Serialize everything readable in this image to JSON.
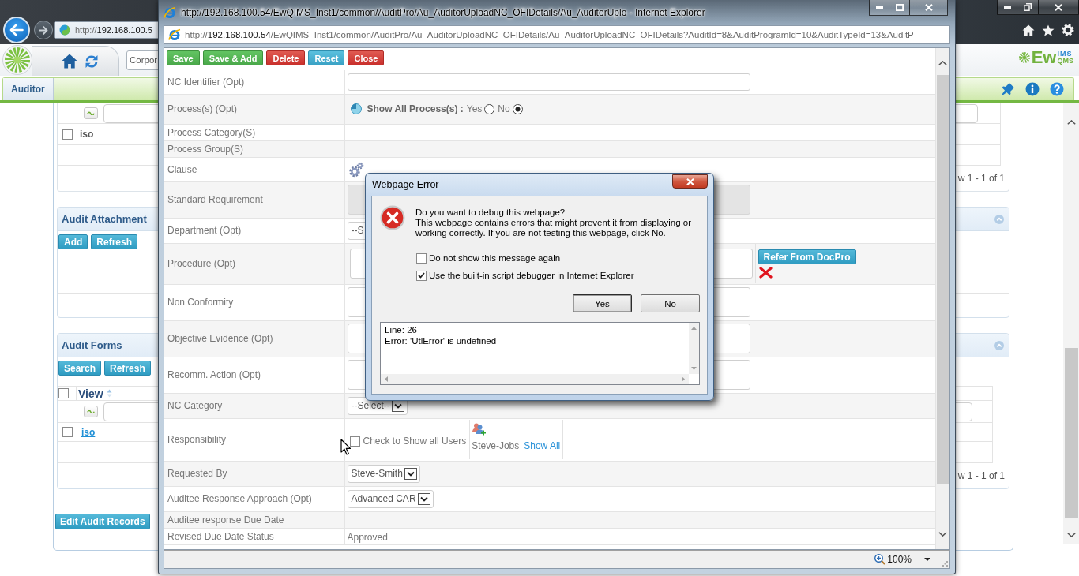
{
  "background_page": {
    "address": {
      "scheme": "http://",
      "host": "192.168.100.5"
    },
    "search_value": "Corpor",
    "brand": {
      "main": "Ew",
      "upper": "IMS",
      "lower": "QMS"
    },
    "tabs": [
      {
        "label": "Auditor",
        "selected": true
      }
    ],
    "top_grid": {
      "rows": [
        {
          "checked": false,
          "text": "iso",
          "link": false
        }
      ],
      "pager": "w 1 - 1 of 1"
    },
    "panels": [
      {
        "title": "Audit Attachment",
        "buttons": [
          "Add",
          "Refresh"
        ]
      },
      {
        "title": "Audit Forms",
        "buttons": [
          "Search",
          "Refresh"
        ],
        "grid": {
          "column": "View",
          "header_checked": false,
          "rows": [
            {
              "checked": false,
              "text": "iso",
              "link": true
            }
          ],
          "pager": "w 1 - 1 of 1"
        }
      }
    ],
    "edit_button": "Edit Audit Records"
  },
  "popup": {
    "title": "http://192.168.100.54/EwQIMS_Inst1/common/AuditPro/Au_AuditorUploadNC_OFIDetails/Au_AuditorUplo - Internet Explorer",
    "address": {
      "scheme": "http://",
      "host": "192.168.100.54",
      "path": "/EwQIMS_Inst1/common/AuditPro/Au_AuditorUploadNC_OFIDetails/Au_AuditorUploadNC_OFIDetails?AuditId=8&AuditProgramId=10&AuditTypeId=13&AuditP"
    },
    "toolbar": [
      {
        "label": "Save",
        "kind": "success"
      },
      {
        "label": "Save & Add",
        "kind": "success"
      },
      {
        "label": "Delete",
        "kind": "danger"
      },
      {
        "label": "Reset",
        "kind": "info"
      },
      {
        "label": "Close",
        "kind": "danger"
      }
    ],
    "form": [
      {
        "label": "NC Identifier (Opt)",
        "kind": "input"
      },
      {
        "label": "Process(s) (Opt)",
        "kind": "radio",
        "prompt": "Show All Process(s) :",
        "options": [
          {
            "label": "Yes",
            "selected": false
          },
          {
            "label": "No",
            "selected": true
          }
        ]
      },
      {
        "label": "Process Category(S)",
        "kind": "empty"
      },
      {
        "label": "Process Group(S)",
        "kind": "empty"
      },
      {
        "label": "Clause",
        "kind": "gear"
      },
      {
        "label": "Standard Requirement",
        "kind": "textarea",
        "disabled": true
      },
      {
        "label": "Department (Opt)",
        "kind": "field",
        "value": "--S"
      },
      {
        "label": "Procedure (Opt)",
        "kind": "textarea",
        "disabled": false,
        "action": "Refer From DocPro"
      },
      {
        "label": "Non Conformity",
        "kind": "textarea",
        "disabled": false
      },
      {
        "label": "Objective Evidence (Opt)",
        "kind": "textarea",
        "disabled": false
      },
      {
        "label": "Recomm. Action (Opt)",
        "kind": "textarea",
        "disabled": false
      },
      {
        "label": "NC Category",
        "kind": "select",
        "value": "--Select--"
      },
      {
        "label": "Responsibility",
        "kind": "users",
        "checkbox": {
          "label": "Check to Show all Users",
          "checked": false
        },
        "user": "Steve-Jobs",
        "link": "Show All"
      },
      {
        "label": "Requested By",
        "kind": "select",
        "value": "Steve-Smith"
      },
      {
        "label": "Auditee Response Approach (Opt)",
        "kind": "select",
        "value": "Advanced CAR"
      },
      {
        "label": "Auditee response Due Date",
        "kind": "empty"
      },
      {
        "label": "Revised Due Date Status",
        "kind": "text",
        "value": "Approved"
      }
    ],
    "zoom": "100%"
  },
  "dialog": {
    "title": "Webpage Error",
    "question": "Do you want to debug this webpage?",
    "message": "This webpage contains errors that might prevent it from displaying or working correctly. If you are not testing this webpage, click No.",
    "options": [
      {
        "label": "Do not show this message again",
        "checked": false
      },
      {
        "label": "Use the built-in script debugger in Internet Explorer",
        "checked": true
      }
    ],
    "buttons": [
      {
        "label": "Yes",
        "default": true
      },
      {
        "label": "No",
        "default": false
      }
    ],
    "details": [
      "Line: 26",
      "Error: 'UtlError' is undefined"
    ]
  }
}
